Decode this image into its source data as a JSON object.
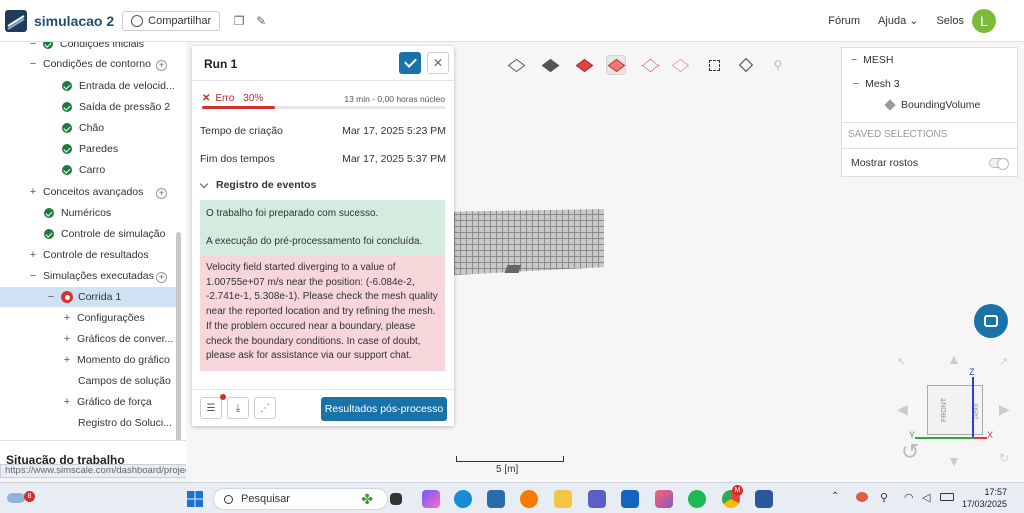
{
  "header": {
    "title": "simulacao 2",
    "share_label": "Compartilhar",
    "forum_label": "Fórum",
    "help_label": "Ajuda",
    "seals_label": "Selos",
    "avatar_initial": "L"
  },
  "tree": {
    "items": [
      {
        "label": "Condições iniciais"
      },
      {
        "label": "Condições de contorno"
      },
      {
        "label": "Entrada de velocid..."
      },
      {
        "label": "Saída de pressão 2"
      },
      {
        "label": "Chão"
      },
      {
        "label": "Paredes"
      },
      {
        "label": "Carro"
      },
      {
        "label": "Conceitos avançados"
      },
      {
        "label": "Numéricos"
      },
      {
        "label": "Controle de simulação"
      },
      {
        "label": "Controle de resultados"
      },
      {
        "label": "Simulações executadas"
      },
      {
        "label": "Corrida 1"
      },
      {
        "label": "Configurações"
      },
      {
        "label": "Gráficos de conver..."
      },
      {
        "label": "Momento do gráfico"
      },
      {
        "label": "Campos de solução"
      },
      {
        "label": "Gráfico de força"
      },
      {
        "label": "Registro do Soluci..."
      }
    ],
    "job_status_title": "Situação do trabalho",
    "status_url": "https://www.simscale.com/dashboard/projects/3411622653847757710/copy/"
  },
  "run_dialog": {
    "title": "Run 1",
    "status_label": "Erro",
    "progress_text": "30%",
    "progress_value": 30,
    "time_info": "13 min - 0,00 horas núcleo",
    "creation_label": "Tempo de criação",
    "creation_value": "Mar 17, 2025 5:23 PM",
    "end_label": "Fim dos tempos",
    "end_value": "Mar 17, 2025 5:37 PM",
    "events_title": "Registro de eventos",
    "events": [
      {
        "type": "success",
        "text": "O trabalho foi preparado com sucesso."
      },
      {
        "type": "success",
        "text": "A execução do pré-processamento foi concluída."
      },
      {
        "type": "error",
        "text": "Velocity field started diverging to a value of 1.00755e+07 m/s near the position: (-6.084e-2, -2.741e-1, 5.308e-1). Please check the mesh quality near the reported location and try refining the mesh. If the problem occured near a boundary, please check the boundary conditions. In case of doubt, please ask for assistance via our support chat."
      }
    ],
    "post_button_label": "Resultados pós-processo"
  },
  "right_panel": {
    "root_label": "MESH",
    "mesh_label": "Mesh 3",
    "child_label": "BoundingVolume",
    "saved_selections_label": "SAVED SELECTIONS",
    "show_faces_label": "Mostrar rostos"
  },
  "viewport": {
    "scale_label": "5 [m]",
    "axis_z": "Z",
    "axis_y": "Y",
    "axis_x": "X",
    "cube_front": "FRONT",
    "cube_right": "RIGHT"
  },
  "taskbar": {
    "search_placeholder": "Pesquisar",
    "time": "17:57",
    "date": "17/03/2025",
    "weather_badge": "8",
    "chrome_badge": "M"
  },
  "colors": {
    "accent": "#1a73a8",
    "error": "#d32f2f",
    "success_bg": "#d4ebdf",
    "error_bg": "#f6d6d8"
  }
}
